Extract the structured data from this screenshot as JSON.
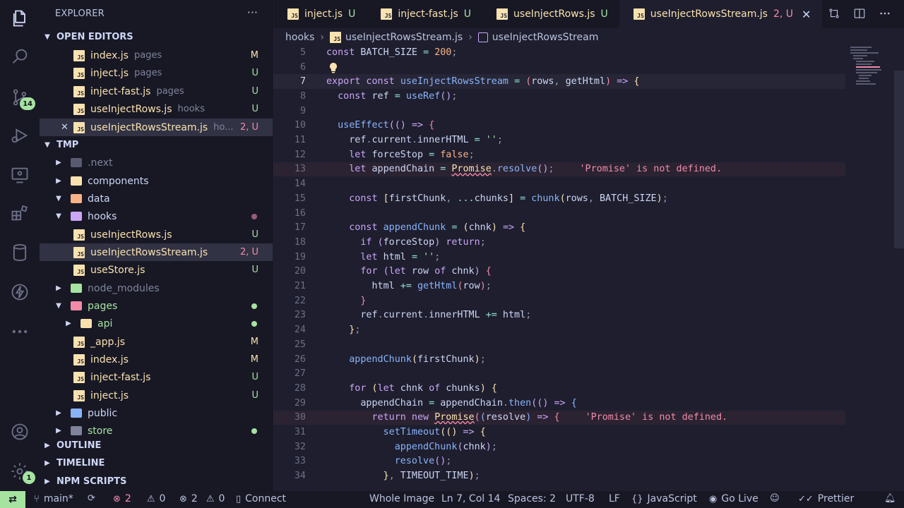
{
  "activity": {
    "scm_badge": "14",
    "settings_badge": "1"
  },
  "sidebar": {
    "title": "EXPLORER",
    "open_editors": {
      "label": "OPEN EDITORS",
      "items": [
        {
          "name": "index.js",
          "desc": "pages",
          "status": "M"
        },
        {
          "name": "inject.js",
          "desc": "pages",
          "status": "U"
        },
        {
          "name": "inject-fast.js",
          "desc": "pages",
          "status": "U"
        },
        {
          "name": "useInjectRows.js",
          "desc": "hooks",
          "status": "U"
        },
        {
          "name": "useInjectRowsStream.js",
          "desc": "ho...",
          "status": "2, U"
        }
      ]
    },
    "tmp": {
      "label": "TMP",
      "items": [
        {
          "name": ".next"
        },
        {
          "name": "components"
        },
        {
          "name": "data"
        },
        {
          "name": "hooks"
        },
        {
          "name": "useInjectRows.js",
          "status": "U"
        },
        {
          "name": "useInjectRowsStream.js",
          "status": "2, U"
        },
        {
          "name": "useStore.js",
          "status": "U"
        },
        {
          "name": "node_modules"
        },
        {
          "name": "pages"
        },
        {
          "name": "api"
        },
        {
          "name": "_app.js",
          "status": "M"
        },
        {
          "name": "index.js",
          "status": "M"
        },
        {
          "name": "inject-fast.js",
          "status": "U"
        },
        {
          "name": "inject.js",
          "status": "U"
        },
        {
          "name": "public"
        },
        {
          "name": "store"
        }
      ]
    },
    "outline": "OUTLINE",
    "timeline": "TIMELINE",
    "npm_scripts": "NPM SCRIPTS"
  },
  "tabs": [
    {
      "name": "inject.js",
      "status": "U"
    },
    {
      "name": "inject-fast.js",
      "status": "U"
    },
    {
      "name": "useInjectRows.js",
      "status": "U"
    },
    {
      "name": "useInjectRowsStream.js",
      "status": "2, U"
    }
  ],
  "breadcrumb": [
    "hooks",
    "useInjectRowsStream.js",
    "useInjectRowsStream"
  ],
  "editor": {
    "line_numbers": [
      "5",
      "6",
      "7",
      "8",
      "9",
      "10",
      "11",
      "12",
      "13",
      "14",
      "15",
      "16",
      "17",
      "18",
      "19",
      "20",
      "21",
      "22",
      "23",
      "24",
      "25",
      "26",
      "27",
      "28",
      "29",
      "30",
      "31",
      "32",
      "33",
      "34"
    ],
    "diagnostic_13": "'Promise' is not defined.",
    "diagnostic_30": "'Promise' is not defined."
  },
  "status": {
    "branch": "main*",
    "errors": "2",
    "warnings": "0",
    "ports_err": "2",
    "ports_warn": "0",
    "connect": "Connect",
    "whole_image": "Whole Image",
    "position": "Ln 7, Col 14",
    "spaces": "Spaces: 2",
    "encoding": "UTF-8",
    "eol": "LF",
    "language": "JavaScript",
    "golive": "Go Live",
    "prettier": "Prettier"
  }
}
